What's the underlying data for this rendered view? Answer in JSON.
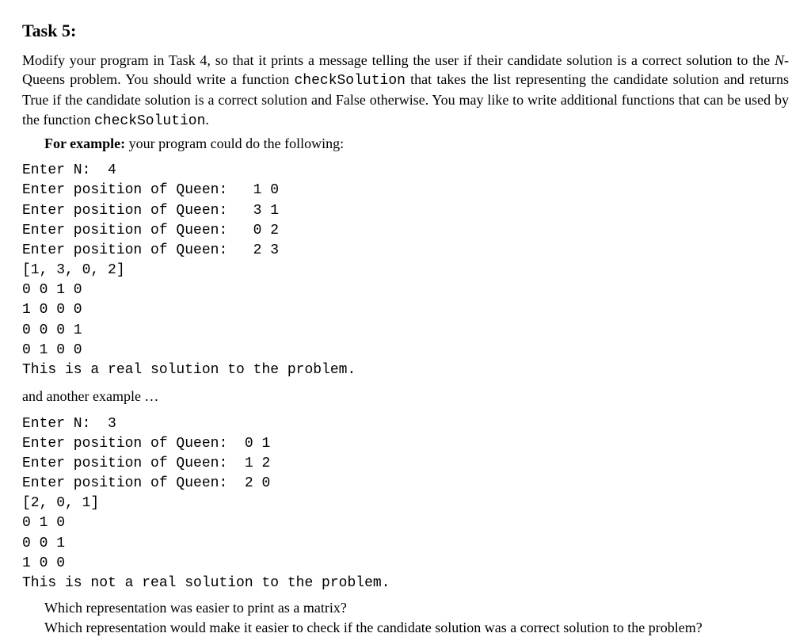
{
  "title": "Task 5:",
  "body": {
    "prefix": "Modify your program in Task 4, so that it prints a message telling the user if their candidate solution is a correct solution to the ",
    "nqueens_italic": "N",
    "nqueens_rest": "-Queens problem.  You should write a function ",
    "funcname1": "checkSolution",
    "mid1": " that takes the list representing the candidate solution and returns True if the candidate solution is a correct solution and False otherwise.  You may like to write additional functions that can be used by the function ",
    "funcname2": "checkSolution",
    "suffix": "."
  },
  "example_intro": {
    "bold": "For example:",
    "rest": " your program could do the following:"
  },
  "code1": "Enter N:  4\nEnter position of Queen:   1 0\nEnter position of Queen:   3 1\nEnter position of Queen:   0 2\nEnter position of Queen:   2 3\n[1, 3, 0, 2]\n0 0 1 0\n1 0 0 0\n0 0 0 1\n0 1 0 0\nThis is a real solution to the problem.",
  "and_another": "and another example …",
  "code2": "Enter N:  3\nEnter position of Queen:  0 1\nEnter position of Queen:  1 2\nEnter position of Queen:  2 0\n[2, 0, 1]\n0 1 0\n0 0 1\n1 0 0\nThis is not a real solution to the problem.",
  "question1": "Which representation was easier to print as a matrix?",
  "question2": "Which representation would make it easier to check if the candidate solution was a correct solution to the problem?"
}
